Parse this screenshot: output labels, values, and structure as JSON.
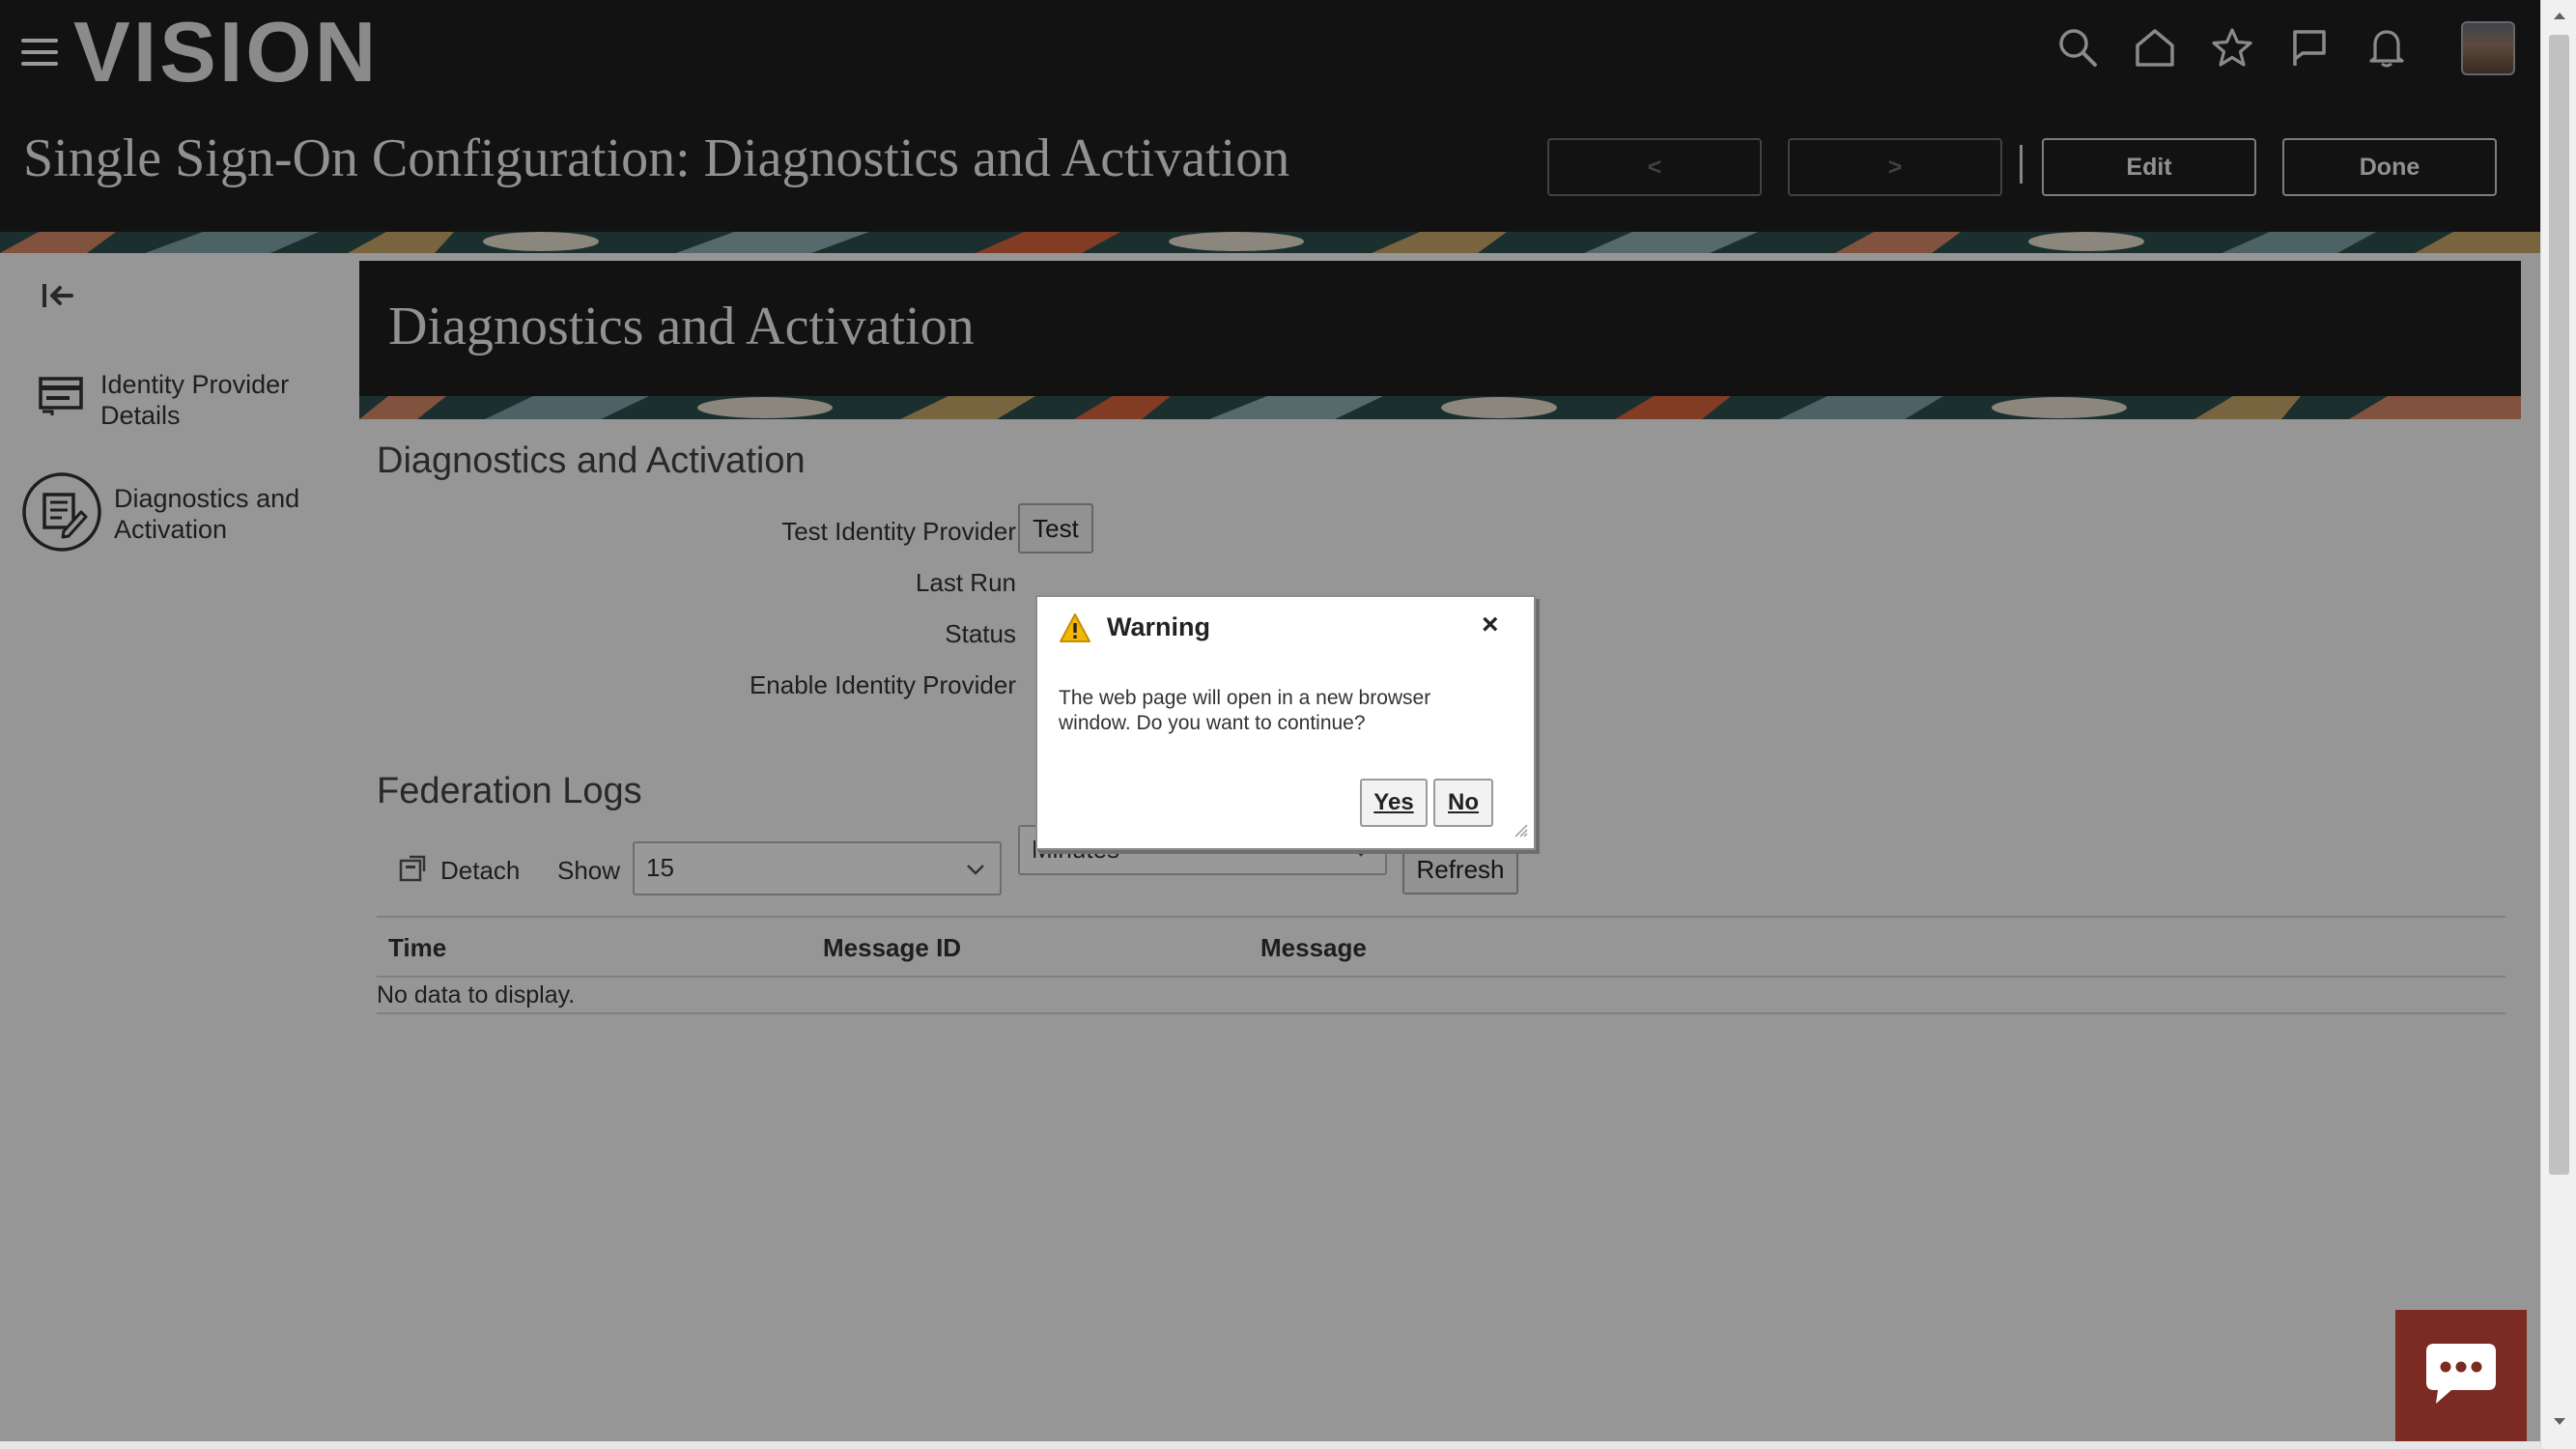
{
  "header": {
    "logo": "VISION",
    "page_title": "Single Sign-On Configuration: Diagnostics and Activation",
    "edit_label": "Edit",
    "done_label": "Done",
    "prev_glyph": "<",
    "next_glyph": ">"
  },
  "global_icons": [
    "search-icon",
    "home-icon",
    "star-icon",
    "flag-icon",
    "bell-icon"
  ],
  "sidebar": {
    "items": [
      {
        "label_line1": "Identity Provider",
        "label_line2": "Details",
        "icon": "card-icon"
      },
      {
        "label_line1": "Diagnostics and",
        "label_line2": "Activation",
        "icon": "edit-document-icon"
      }
    ]
  },
  "content": {
    "header_title": "Diagnostics and Activation",
    "section_title": "Diagnostics and Activation",
    "fields": {
      "test_idp_label": "Test Identity Provider",
      "test_button": "Test",
      "last_run_label": "Last Run",
      "status_label": "Status",
      "enable_idp_label": "Enable Identity Provider"
    },
    "logs": {
      "title": "Federation Logs",
      "detach_label": "Detach",
      "show_label": "Show",
      "show_value": "15",
      "unit_value": "Minutes",
      "refresh_label": "Refresh",
      "columns": [
        "Time",
        "Message ID",
        "Message"
      ],
      "empty_text": "No data to display."
    }
  },
  "dialog": {
    "title": "Warning",
    "close_glyph": "×",
    "message": "The web page will open in a new browser window. Do you want to continue?",
    "yes_label": "Yes",
    "no_label": "No"
  },
  "colors": {
    "header_bg": "#1e1e1e",
    "chat_bg": "#7c2b22",
    "warning_yellow": "#f2b705"
  }
}
